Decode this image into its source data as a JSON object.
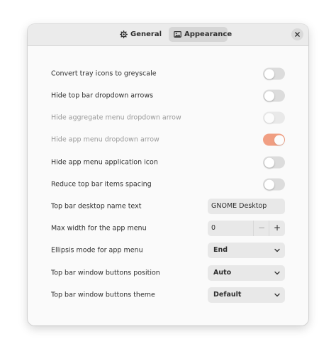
{
  "header": {
    "tabs": [
      {
        "label": "General",
        "icon": "gear-icon"
      },
      {
        "label": "Appearance",
        "icon": "image-icon",
        "active": true
      }
    ]
  },
  "settings": [
    {
      "label": "Convert tray icons to greyscale",
      "control": "switch",
      "on": false,
      "enabled": true
    },
    {
      "label": "Hide top bar dropdown arrows",
      "control": "switch",
      "on": false,
      "enabled": true
    },
    {
      "label": "Hide aggregate menu dropdown arrow",
      "control": "switch",
      "on": false,
      "enabled": false
    },
    {
      "label": "Hide app menu dropdown arrow",
      "control": "switch",
      "on": true,
      "enabled": false
    },
    {
      "label": "Hide app menu application icon",
      "control": "switch",
      "on": false,
      "enabled": true
    },
    {
      "label": "Reduce top bar items spacing",
      "control": "switch",
      "on": false,
      "enabled": true
    },
    {
      "label": "Top bar desktop name text",
      "control": "entry",
      "value": "GNOME Desktop"
    },
    {
      "label": "Max width for the app menu",
      "control": "spin",
      "value": "0",
      "minus": "−",
      "plus": "+"
    },
    {
      "label": "Ellipsis mode for app menu",
      "control": "dropdown",
      "value": "End"
    },
    {
      "label": "Top bar window buttons position",
      "control": "dropdown",
      "value": "Auto"
    },
    {
      "label": "Top bar window buttons theme",
      "control": "dropdown",
      "value": "Default"
    }
  ],
  "colors": {
    "accent": "#e95420",
    "switch_off": "#dcdcdc",
    "text": "#2e2e2e",
    "text_disabled": "#9a9a9a"
  }
}
